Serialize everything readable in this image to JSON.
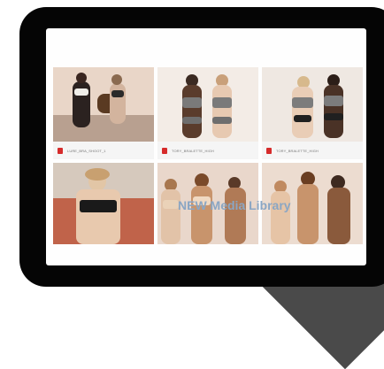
{
  "files": [
    {
      "name": "LURE_BRA_SHOOT_1"
    },
    {
      "name": "TORY_BRALETTE_HIGH"
    },
    {
      "name": "TORY_BRALETTE_HIGH"
    }
  ],
  "overlay_text": "NEW Media Library",
  "colors": {
    "file_icon": "#d62b2b",
    "overlay": "#8aa6c4",
    "tablet": "#050505"
  }
}
